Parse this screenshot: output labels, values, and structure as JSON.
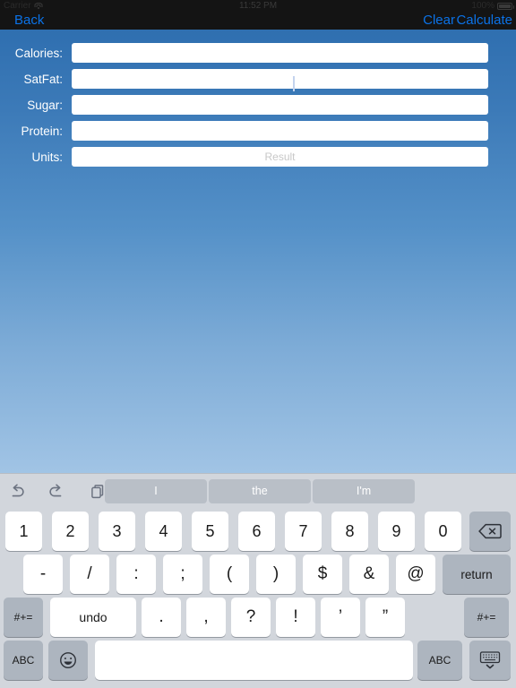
{
  "statusbar": {
    "carrier": "Carrier",
    "time": "11:52 PM",
    "battery": "100%",
    "wifi_icon": "wifi-icon",
    "battery_icon": "battery-icon"
  },
  "navbar": {
    "back_label": "Back",
    "clear_label": "Clear",
    "calculate_label": "Calculate",
    "tint_color": "#0b72e7",
    "background_color": "#141414"
  },
  "form": {
    "background_gradient_top": "#2f6fb0",
    "background_gradient_bottom": "#a1c4e5",
    "fields": [
      {
        "label": "Calories:",
        "value": "",
        "placeholder": "",
        "focused": true
      },
      {
        "label": "SatFat:",
        "value": "",
        "placeholder": "",
        "focused": false
      },
      {
        "label": "Sugar:",
        "value": "",
        "placeholder": "",
        "focused": false
      },
      {
        "label": "Protein:",
        "value": "",
        "placeholder": "",
        "focused": false
      },
      {
        "label": "Units:",
        "value": "",
        "placeholder": "Result",
        "focused": false
      }
    ]
  },
  "keyboard": {
    "background_color": "#d2d6dc",
    "predictive": {
      "icons": [
        "undo-icon",
        "redo-icon",
        "paste-icon"
      ],
      "suggestions": [
        "I",
        "the",
        "I'm"
      ]
    },
    "rows": {
      "row1": [
        "1",
        "2",
        "3",
        "4",
        "5",
        "6",
        "7",
        "8",
        "9",
        "0"
      ],
      "row1_action": "backspace-icon",
      "row2": [
        "-",
        "/",
        ":",
        ";",
        "(",
        ")",
        "$",
        "&",
        "@"
      ],
      "row2_action": "return",
      "row3_left": "#+=",
      "row3": [
        "undo",
        ".",
        ",",
        "?",
        "!",
        "’",
        "”"
      ],
      "row3_right": "#+=",
      "row4_left": "ABC",
      "row4_emoji": "emoji-icon",
      "row4_space": "",
      "row4_abc": "ABC",
      "row4_dismiss": "hide-keyboard-icon"
    }
  }
}
